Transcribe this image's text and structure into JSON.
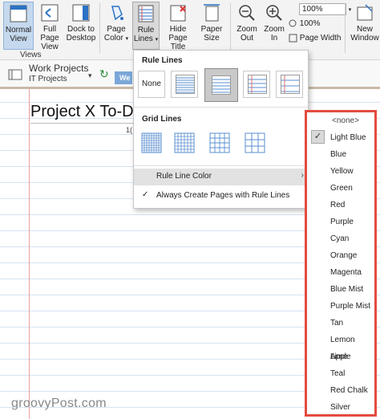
{
  "ribbon": {
    "normal_view": "Normal View",
    "full_page_view": "Full Page View",
    "dock_to_desktop": "Dock to Desktop",
    "page_color": "Page Color",
    "rule_lines": "Rule Lines",
    "hide_page_title": "Hide Page Title",
    "paper_size": "Paper Size",
    "zoom_out": "Zoom Out",
    "zoom_in": "Zoom In",
    "zoom_level": "100%",
    "zoom_100": "100%",
    "page_width": "Page Width",
    "new_window": "New Window",
    "views_group": "Views"
  },
  "notebook": {
    "name": "Work Projects",
    "section": "IT Projects",
    "section_tab": "We"
  },
  "page": {
    "title": "Project X To-Do",
    "date_stub": "1("
  },
  "rule_menu": {
    "rule_lines_header": "Rule Lines",
    "none_label": "None",
    "grid_lines_header": "Grid Lines",
    "rule_line_color": "Rule Line Color",
    "always_create": "Always Create Pages with Rule Lines",
    "arrow": "›",
    "check": "✓"
  },
  "color_menu": {
    "items": [
      "<none>",
      "Light Blue",
      "Blue",
      "Yellow",
      "Green",
      "Red",
      "Purple",
      "Cyan",
      "Orange",
      "Magenta",
      "Blue Mist",
      "Purple Mist",
      "Tan",
      "Lemon Lime",
      "Apple",
      "Teal",
      "Red Chalk",
      "Silver"
    ],
    "selected": "Light Blue",
    "check": "✓"
  },
  "watermark": "groovyPost.com",
  "colors": {
    "ribbon_bg": "#f3f3f3",
    "selected_blue": "#c5d9ee",
    "rule_line": "#d6e3f3",
    "margin_line": "#e7a0a0",
    "highlight_border": "#e34b3f",
    "section_tab": "#7ba7d8"
  }
}
